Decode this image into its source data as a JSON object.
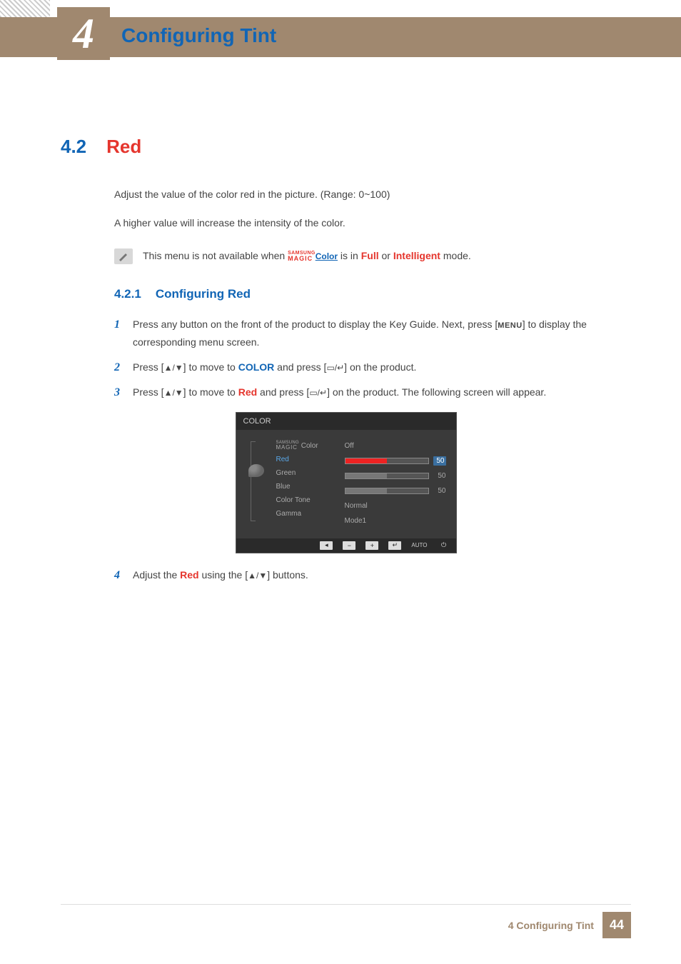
{
  "chapter": {
    "number": "4",
    "title": "Configuring Tint"
  },
  "section": {
    "number": "4.2",
    "title": "Red"
  },
  "intro": {
    "p1": "Adjust the value of the color red in the picture. (Range: 0~100)",
    "p2": "A higher value will increase the intensity of the color."
  },
  "note": {
    "prefix": "This menu is not available when ",
    "brand_top": "SAMSUNG",
    "brand_bottom": "MAGIC",
    "brand_word": "Color",
    "mid": " is in ",
    "mode1": "Full",
    "or": " or ",
    "mode2": "Intelligent",
    "suffix": " mode."
  },
  "subsection": {
    "number": "4.2.1",
    "title": "Configuring Red"
  },
  "steps": {
    "s1": {
      "n": "1",
      "t1": "Press any button on the front of the product to display the Key Guide. Next, press [",
      "menu": "MENU",
      "t2": "] to display the corresponding menu screen."
    },
    "s2": {
      "n": "2",
      "t1": "Press [",
      "arrows": "▲/▼",
      "t2": "] to move to ",
      "kw": "COLOR",
      "t3": " and press [",
      "enter": "▭/↵",
      "t4": "] on the product."
    },
    "s3": {
      "n": "3",
      "t1": "Press [",
      "arrows": "▲/▼",
      "t2": "] to move to ",
      "kw": "Red",
      "t3": " and press [",
      "enter": "▭/↵",
      "t4": "] on the product. The following screen will appear."
    },
    "s4": {
      "n": "4",
      "t1": "Adjust the ",
      "kw": "Red",
      "t2": " using the [",
      "arrows": "▲/▼",
      "t3": "] buttons."
    }
  },
  "osd": {
    "title": "COLOR",
    "items": {
      "magic_top": "SAMSUNG",
      "magic_bot": "MAGIC",
      "magic_word": " Color",
      "red": "Red",
      "green": "Green",
      "blue": "Blue",
      "tone": "Color Tone",
      "gamma": "Gamma"
    },
    "values": {
      "magic": "Off",
      "red": "50",
      "green": "50",
      "blue": "50",
      "tone": "Normal",
      "gamma": "Mode1"
    },
    "footer": {
      "auto": "AUTO"
    }
  },
  "footer": {
    "text": "4 Configuring Tint",
    "page": "44"
  }
}
